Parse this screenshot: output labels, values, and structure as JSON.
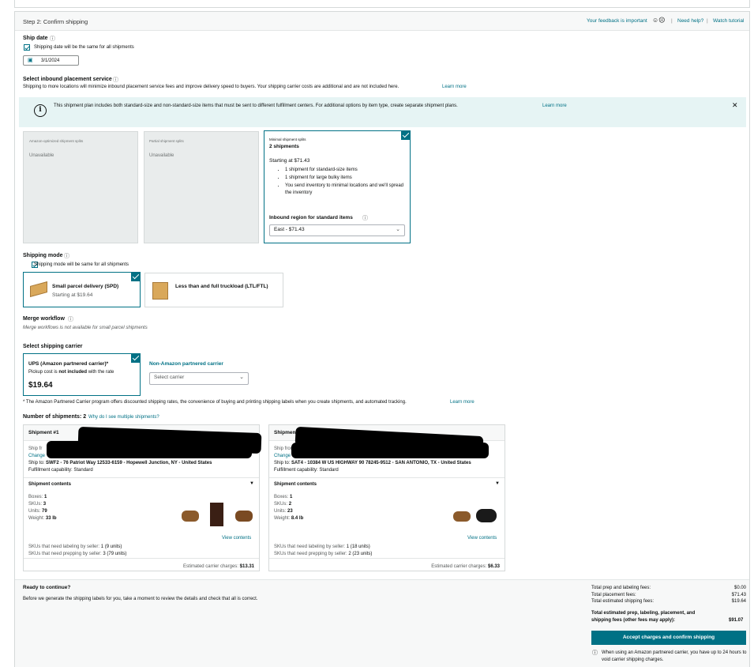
{
  "header": {
    "step_title": "Step 2: Confirm shipping",
    "feedback": "Your feedback is important",
    "feedback_icons": "☺☹",
    "sep": "|",
    "need_help": "Need help?",
    "watch_tutorial": "Watch tutorial"
  },
  "ship_date": {
    "label": "Ship date",
    "same_checkbox": "Shipping date will be the same for all shipments",
    "value": "3/1/2024"
  },
  "placement": {
    "label": "Select inbound placement service",
    "desc": "Shipping to more locations will minimize inbound placement service fees and improve delivery speed to buyers. Your shipping carrier costs are additional and are not included here.",
    "learn_more": "Learn more",
    "info_text": "This shipment plan includes both standard-size and non-standard-size items that must be sent to different fulfillment centers. For additional options by item type, create separate shipment plans.",
    "info_learn_more": "Learn more",
    "options": [
      {
        "title": "Amazon-optimized shipment splits",
        "status": "Unavailable"
      },
      {
        "title": "Partial shipment splits",
        "status": "Unavailable"
      },
      {
        "title": "Minimal shipment splits",
        "count": "2 shipments",
        "starting": "Starting at $71.43",
        "bullets": [
          "1 shipment for standard-size items",
          "1 shipment for large bulky items",
          "You send inventory to minimal locations and we'll spread the inventory"
        ],
        "region_label": "Inbound region for standard items",
        "region_value": "East - $71.43"
      }
    ]
  },
  "shipping_mode": {
    "label": "Shipping mode",
    "same_checkbox": "Shipping mode will be same for all shipments",
    "options": [
      {
        "title": "Small parcel delivery (SPD)",
        "sub": "Starting at $19.64"
      },
      {
        "title": "Less than and full truckload (LTL/FTL)"
      }
    ]
  },
  "merge": {
    "label": "Merge workflow",
    "note": "Merge workflows is not available for small parcel shipments"
  },
  "carrier": {
    "label": "Select shipping carrier",
    "ups_title": "UPS (Amazon partnered carrier)*",
    "ups_sub_a": "Pickup cost is",
    "ups_sub_b": "not included",
    "ups_sub_c": "with the rate",
    "ups_price": "$19.64",
    "non_title": "Non-Amazon partnered carrier",
    "non_select": "Select carrier",
    "footnote": "* The Amazon Partnered Carrier program offers discounted shipping rates, the convenience of buying and printing shipping labels when you create shipments, and automated tracking.",
    "footnote_link": "Learn more"
  },
  "shipments_header": {
    "label": "Number of shipments: 2",
    "why": "Why do I see multiple shipments?"
  },
  "shipments": [
    {
      "title": "Shipment #1",
      "ship_from": "Ship fr",
      "change": "Change",
      "ship_to_label": "Ship to:",
      "ship_to": "SWF2 - 76 Patriot Way 12533-6159 - Hopewell Junction, NY - United States",
      "capability": "Fulfillment capability: Standard",
      "contents_label": "Shipment contents",
      "boxes": "1",
      "skus": "3",
      "units": "79",
      "weight": "33 lb",
      "view_contents": "View contents",
      "labeling": "SKUs that need labeling by seller:",
      "labeling_val": "1 (9 units)",
      "prepping": "SKUs that need prepping by seller:",
      "prepping_val": "3 (79 units)",
      "est_label": "Estimated carrier charges:",
      "est_val": "$13.31"
    },
    {
      "title": "Shipment #2",
      "ship_from": "Ship from",
      "change": "Change",
      "ship_to_label": "Ship to:",
      "ship_to": "SAT4 - 10384 W US HIGHWAY 90 78245-9512 - SAN ANTONIO, TX - United States",
      "capability": "Fulfillment capability: Standard",
      "contents_label": "Shipment contents",
      "boxes": "1",
      "skus": "2",
      "units": "23",
      "weight": "8.4 lb",
      "view_contents": "View contents",
      "labeling": "SKUs that need labeling by seller:",
      "labeling_val": "1 (18 units)",
      "prepping": "SKUs that need prepping by seller:",
      "prepping_val": "2 (23 units)",
      "est_label": "Estimated carrier charges:",
      "est_val": "$6.33"
    }
  ],
  "contents_labels": {
    "boxes": "Boxes:",
    "skus": "SKUs:",
    "units": "Units:",
    "weight": "Weight:"
  },
  "footer": {
    "ready": "Ready to continue?",
    "ready_desc": "Before we generate the shipping labels for you, take a moment to review the details and check that all is correct.",
    "fees": [
      {
        "label": "Total prep and labeling fees:",
        "value": "$0.00"
      },
      {
        "label": "Total placement fees:",
        "value": "$71.43"
      },
      {
        "label": "Total estimated shipping fees:",
        "value": "$19.64"
      }
    ],
    "total_label": "Total estimated prep, labeling, placement, and shipping fees (other fees may apply):",
    "total_value": "$91.07",
    "accept_button": "Accept charges and confirm shipping",
    "note": "When using an Amazon partnered carrier, you have up to 24 hours to void carrier shipping charges."
  },
  "colors": {
    "accent": "#007185",
    "info_bg": "#e6f4f4",
    "disabled_bg": "#e9ecec"
  }
}
